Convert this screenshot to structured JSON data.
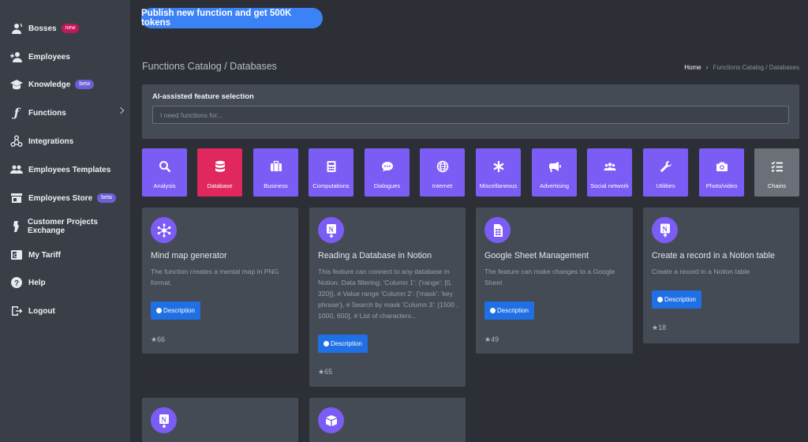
{
  "sidebar": {
    "items": [
      {
        "label": "Bosses",
        "badge": "new",
        "icon": "bosses-icon"
      },
      {
        "label": "Employees",
        "icon": "add-user-icon"
      },
      {
        "label": "Knowledge",
        "badge": "beta",
        "icon": "graduation-cap-icon"
      },
      {
        "label": "Functions",
        "icon": "function-icon"
      },
      {
        "label": "Integrations",
        "icon": "integrations-icon"
      },
      {
        "label": "Employees Templates",
        "icon": "users-icon"
      },
      {
        "label": "Employees Store",
        "badge": "beta",
        "icon": "store-icon"
      },
      {
        "label": "Customer Projects Exchange",
        "icon": "exchange-icon"
      },
      {
        "label": "My Tariff",
        "icon": "tariff-icon"
      },
      {
        "label": "Help",
        "icon": "help-icon"
      },
      {
        "label": "Logout",
        "icon": "logout-icon"
      }
    ]
  },
  "promo": {
    "label": "Publish new function and get 500K tokens"
  },
  "header": {
    "title": "Functions Catalog / Databases",
    "breadcrumb": {
      "home": "Home",
      "current": "Functions Catalog / Databases"
    }
  },
  "ai_search": {
    "label": "AI-assisted feature selection",
    "placeholder": "I need functions for..."
  },
  "categories": [
    {
      "label": "Analysis",
      "icon": "search-icon"
    },
    {
      "label": "Database",
      "icon": "database-icon",
      "active": true
    },
    {
      "label": "Business",
      "icon": "briefcase-icon"
    },
    {
      "label": "Computations",
      "icon": "calculator-icon"
    },
    {
      "label": "Dialogues",
      "icon": "chat-icon"
    },
    {
      "label": "Internet",
      "icon": "globe-icon"
    },
    {
      "label": "Miscellaneous",
      "icon": "asterisk-icon"
    },
    {
      "label": "Advertising",
      "icon": "megaphone-icon"
    },
    {
      "label": "Social network",
      "icon": "people-icon"
    },
    {
      "label": "Utilities",
      "icon": "wrench-icon"
    },
    {
      "label": "Photo/video",
      "icon": "camera-icon"
    },
    {
      "label": "Chains",
      "icon": "list-check-icon"
    }
  ],
  "cards": [
    {
      "title": "Mind map generator",
      "desc": "The function creates a mental map in PNG format.",
      "button": "Description",
      "rating": "66",
      "icon": "mind-map-icon"
    },
    {
      "title": "Reading a Database in Notion",
      "desc": "This feature can connect to any database in Notion. Data filtering: 'Column 1': {'range': [0, 320]}, # Value range 'Column 2': {'mask': 'key phrase'}, # Search by mask 'Column 3': [1500 , 1000, 600], # List of characters...",
      "button": "Description",
      "rating": "65",
      "icon": "notion-download-icon"
    },
    {
      "title": "Google Sheet Management",
      "desc": "The feature can make changes to a Google Sheet",
      "button": "Description",
      "rating": "49",
      "icon": "google-sheet-icon"
    },
    {
      "title": "Create a record in a Notion table",
      "desc": "Create a record in a Notion table",
      "button": "Description",
      "rating": "18",
      "icon": "notion-upload-icon"
    },
    {
      "icon": "notion-download-icon"
    },
    {
      "icon": "airtable-icon"
    }
  ],
  "colors": {
    "accent": "#7b5cf5",
    "active": "#e0285f",
    "primary": "#1f6fe5",
    "promo": "#3b82f6"
  }
}
